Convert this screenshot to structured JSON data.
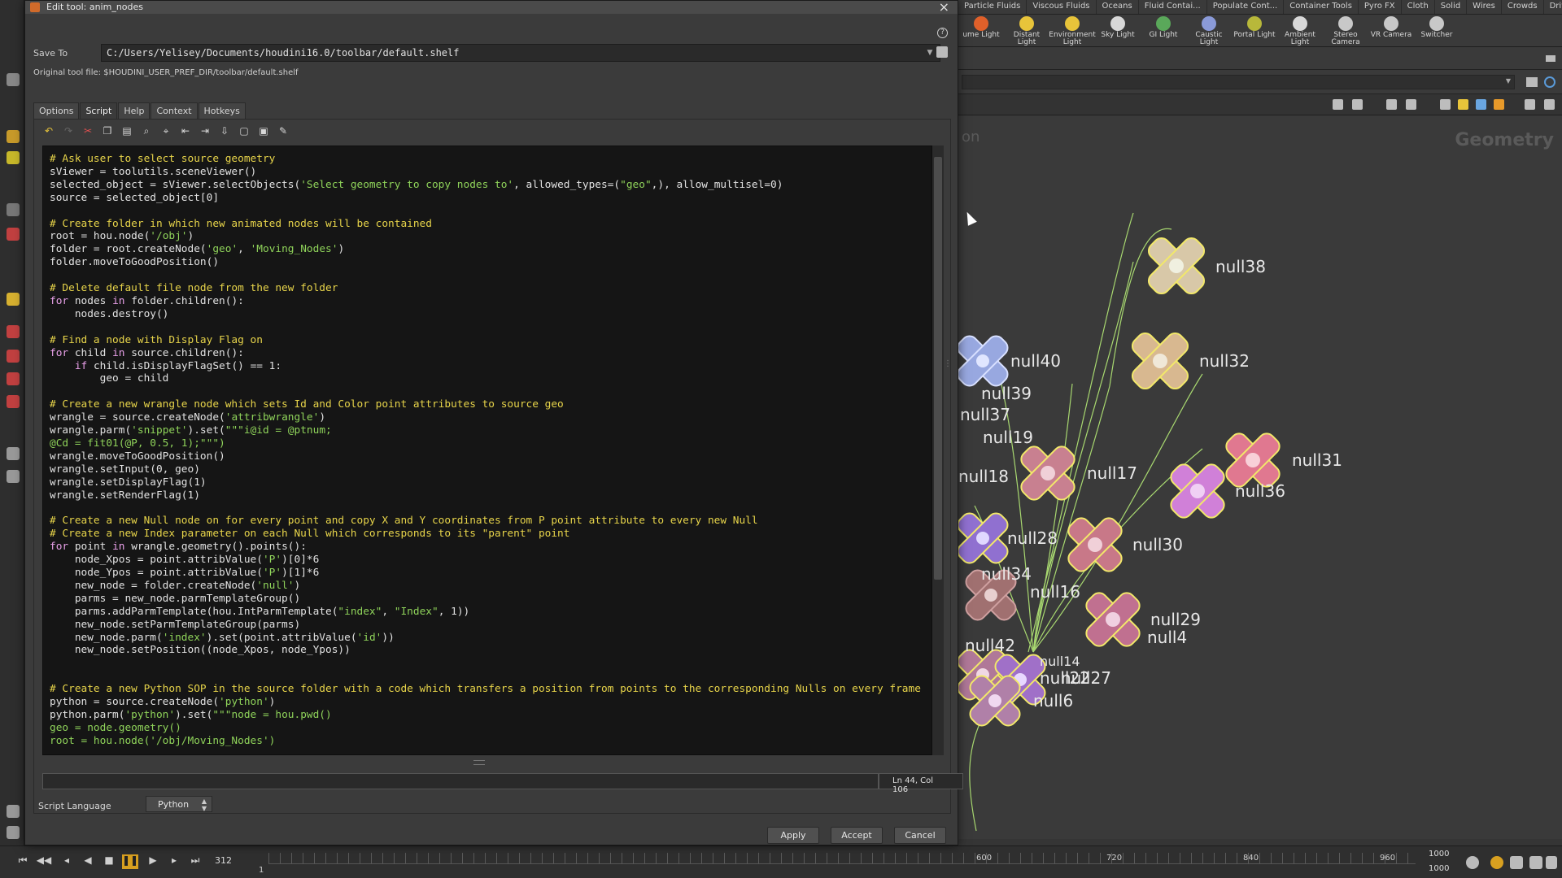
{
  "dialog": {
    "title": "Edit tool: anim_nodes",
    "save_to_label": "Save To",
    "save_to_value": "C:/Users/Yelisey/Documents/houdini16.0/toolbar/default.shelf",
    "original_file": "Original tool file: $HOUDINI_USER_PREF_DIR/toolbar/default.shelf",
    "tabs": [
      "Options",
      "Script",
      "Help",
      "Context",
      "Hotkeys"
    ],
    "active_tab": "Script",
    "cursor_position": "Ln 44, Col 106",
    "script_language_label": "Script Language",
    "script_language_value": "Python",
    "buttons": {
      "apply": "Apply",
      "accept": "Accept",
      "cancel": "Cancel"
    }
  },
  "code_lines": [
    {
      "t": "cmt",
      "s": "# Ask user to select source geometry"
    },
    {
      "t": "code",
      "s": "sViewer = toolutils.sceneViewer()"
    },
    {
      "t": "mix",
      "parts": [
        [
          "",
          "selected_object = sViewer.selectObjects("
        ],
        [
          "str",
          "'Select geometry to copy nodes to'"
        ],
        [
          "",
          ", allowed_types=("
        ],
        [
          "str",
          "\"geo\""
        ],
        [
          "",
          ",), allow_multisel=0)"
        ]
      ]
    },
    {
      "t": "code",
      "s": "source = selected_object[0]"
    },
    {
      "t": "code",
      "s": ""
    },
    {
      "t": "cmt",
      "s": "# Create folder in which new animated nodes will be contained"
    },
    {
      "t": "mix",
      "parts": [
        [
          "",
          "root = hou.node("
        ],
        [
          "str",
          "'/obj'"
        ],
        [
          "",
          ")"
        ]
      ]
    },
    {
      "t": "mix",
      "parts": [
        [
          "",
          "folder = root.createNode("
        ],
        [
          "str",
          "'geo'"
        ],
        [
          "",
          ", "
        ],
        [
          "str",
          "'Moving_Nodes'"
        ],
        [
          "",
          ")"
        ]
      ]
    },
    {
      "t": "code",
      "s": "folder.moveToGoodPosition()"
    },
    {
      "t": "code",
      "s": ""
    },
    {
      "t": "cmt",
      "s": "# Delete default file node from the new folder"
    },
    {
      "t": "mix",
      "parts": [
        [
          "kw",
          "for"
        ],
        [
          "",
          " nodes "
        ],
        [
          "kw",
          "in"
        ],
        [
          "",
          " folder.children():"
        ]
      ]
    },
    {
      "t": "code",
      "s": "    nodes.destroy()"
    },
    {
      "t": "code",
      "s": ""
    },
    {
      "t": "cmt",
      "s": "# Find a node with Display Flag on"
    },
    {
      "t": "mix",
      "parts": [
        [
          "kw",
          "for"
        ],
        [
          "",
          " child "
        ],
        [
          "kw",
          "in"
        ],
        [
          "",
          " source.children():"
        ]
      ]
    },
    {
      "t": "mix",
      "parts": [
        [
          "",
          "    "
        ],
        [
          "kw",
          "if"
        ],
        [
          "",
          " child.isDisplayFlagSet() == 1:"
        ]
      ]
    },
    {
      "t": "code",
      "s": "        geo = child"
    },
    {
      "t": "code",
      "s": ""
    },
    {
      "t": "cmt",
      "s": "# Create a new wrangle node which sets Id and Color point attributes to source geo"
    },
    {
      "t": "mix",
      "parts": [
        [
          "",
          "wrangle = source.createNode("
        ],
        [
          "str",
          "'attribwrangle'"
        ],
        [
          "",
          ")"
        ]
      ]
    },
    {
      "t": "mix",
      "parts": [
        [
          "",
          "wrangle.parm("
        ],
        [
          "str",
          "'snippet'"
        ],
        [
          "",
          ").set("
        ],
        [
          "str",
          "\"\"\"i@id = @ptnum;"
        ]
      ]
    },
    {
      "t": "str",
      "s": "@Cd = fit01(@P, 0.5, 1);\"\"\")"
    },
    {
      "t": "code",
      "s": "wrangle.moveToGoodPosition()"
    },
    {
      "t": "code",
      "s": "wrangle.setInput(0, geo)"
    },
    {
      "t": "code",
      "s": "wrangle.setDisplayFlag(1)"
    },
    {
      "t": "code",
      "s": "wrangle.setRenderFlag(1)"
    },
    {
      "t": "code",
      "s": ""
    },
    {
      "t": "cmt",
      "s": "# Create a new Null node on for every point and copy X and Y coordinates from P point attribute to every new Null"
    },
    {
      "t": "cmt",
      "s": "# Create a new Index parameter on each Null which corresponds to its \"parent\" point"
    },
    {
      "t": "mix",
      "parts": [
        [
          "kw",
          "for"
        ],
        [
          "",
          " point "
        ],
        [
          "kw",
          "in"
        ],
        [
          "",
          " wrangle.geometry().points():"
        ]
      ]
    },
    {
      "t": "mix",
      "parts": [
        [
          "",
          "    node_Xpos = point.attribValue("
        ],
        [
          "str",
          "'P'"
        ],
        [
          "",
          ")[0]*6"
        ]
      ]
    },
    {
      "t": "mix",
      "parts": [
        [
          "",
          "    node_Ypos = point.attribValue("
        ],
        [
          "str",
          "'P'"
        ],
        [
          "",
          ")[1]*6"
        ]
      ]
    },
    {
      "t": "mix",
      "parts": [
        [
          "",
          "    new_node = folder.createNode("
        ],
        [
          "str",
          "'null'"
        ],
        [
          "",
          ")"
        ]
      ]
    },
    {
      "t": "code",
      "s": "    parms = new_node.parmTemplateGroup()"
    },
    {
      "t": "mix",
      "parts": [
        [
          "",
          "    parms.addParmTemplate(hou.IntParmTemplate("
        ],
        [
          "str",
          "\"index\""
        ],
        [
          "",
          ", "
        ],
        [
          "str",
          "\"Index\""
        ],
        [
          "",
          ", 1))"
        ]
      ]
    },
    {
      "t": "code",
      "s": "    new_node.setParmTemplateGroup(parms)"
    },
    {
      "t": "mix",
      "parts": [
        [
          "",
          "    new_node.parm("
        ],
        [
          "str",
          "'index'"
        ],
        [
          "",
          ").set(point.attribValue("
        ],
        [
          "str",
          "'id'"
        ],
        [
          "",
          "))"
        ]
      ]
    },
    {
      "t": "code",
      "s": "    new_node.setPosition((node_Xpos, node_Ypos))"
    },
    {
      "t": "code",
      "s": ""
    },
    {
      "t": "code",
      "s": ""
    },
    {
      "t": "cmt",
      "s": "# Create a new Python SOP in the source folder with a code which transfers a position from points to the corresponding Nulls on every frame"
    },
    {
      "t": "mix",
      "parts": [
        [
          "",
          "python = source.createNode("
        ],
        [
          "str",
          "'python'"
        ],
        [
          "",
          ")"
        ]
      ]
    },
    {
      "t": "mix",
      "parts": [
        [
          "",
          "python.parm("
        ],
        [
          "str",
          "'python'"
        ],
        [
          "",
          ").set("
        ],
        [
          "str",
          "\"\"\"node = hou.pwd()"
        ]
      ]
    },
    {
      "t": "str",
      "s": "geo = node.geometry()"
    },
    {
      "t": "str",
      "s": "root = hou.node('/obj/Moving_Nodes')"
    }
  ],
  "shelf": {
    "tabs": [
      "Particle Fluids",
      "Viscous Fluids",
      "Oceans",
      "Fluid Contai...",
      "Populate Cont...",
      "Container Tools",
      "Pyro FX",
      "Cloth",
      "Solid",
      "Wires",
      "Crowds",
      "Drive Simula..."
    ],
    "tools": [
      {
        "label": "ume Light",
        "color": "#e0602a"
      },
      {
        "label": "Distant Light",
        "color": "#e8c43a"
      },
      {
        "label": "Environment Light",
        "color": "#e8c43a"
      },
      {
        "label": "Sky Light",
        "color": "#d8d8d8"
      },
      {
        "label": "GI Light",
        "color": "#5aa85a"
      },
      {
        "label": "Caustic Light",
        "color": "#8a9ad8"
      },
      {
        "label": "Portal Light",
        "color": "#b8b83a"
      },
      {
        "label": "Ambient Light",
        "color": "#d8d8d8"
      },
      {
        "label": "Stereo Camera",
        "color": "#c8c8c8"
      },
      {
        "label": "VR Camera",
        "color": "#c8c8c8"
      },
      {
        "label": "Switcher",
        "color": "#c8c8c8"
      }
    ]
  },
  "network": {
    "context_label": "Geometry",
    "partial_label": "on",
    "nodes": [
      "null38",
      "null40",
      "null39",
      "null37",
      "null19",
      "null32",
      "null17",
      "null18",
      "null31",
      "null36",
      "null28",
      "null30",
      "null34",
      "null16",
      "null29",
      "null4",
      "null42",
      "null22",
      "null27",
      "null6",
      "null14"
    ]
  },
  "timeline": {
    "current_frame": "312",
    "start_frame": "1",
    "ticks": [
      "600",
      "720",
      "840",
      "960"
    ],
    "end_frame_1": "1000",
    "end_frame_2": "1000"
  }
}
